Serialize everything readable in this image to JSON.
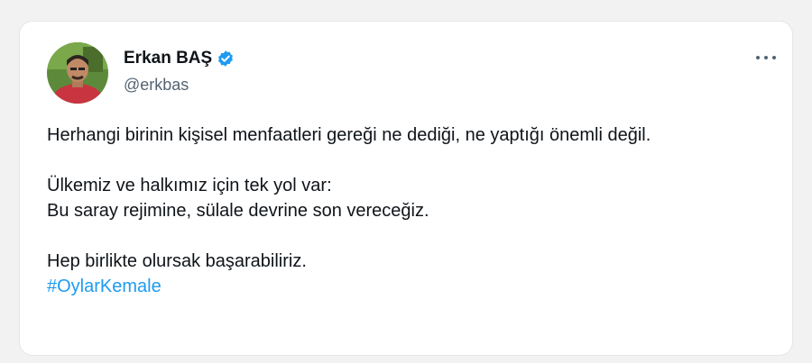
{
  "author": {
    "name": "Erkan BAŞ",
    "handle": "@erkbas",
    "verified": true,
    "verified_color": "#1d9bf0"
  },
  "tweet": {
    "para1": "Herhangi birinin kişisel menfaatleri gereği ne dediği, ne yaptığı önemli değil.",
    "para2_line1": "Ülkemiz ve halkımız için tek yol var:",
    "para2_line2": "Bu saray rejimine, sülale devrine son vereceğiz.",
    "para3": "Hep birlikte olursak başarabiliriz.",
    "hashtag": "#OylarKemale"
  },
  "icons": {
    "more": "more-options-icon",
    "verified": "verified-badge-icon"
  },
  "colors": {
    "text": "#0f1419",
    "secondary": "#536471",
    "link": "#1d9bf0"
  }
}
